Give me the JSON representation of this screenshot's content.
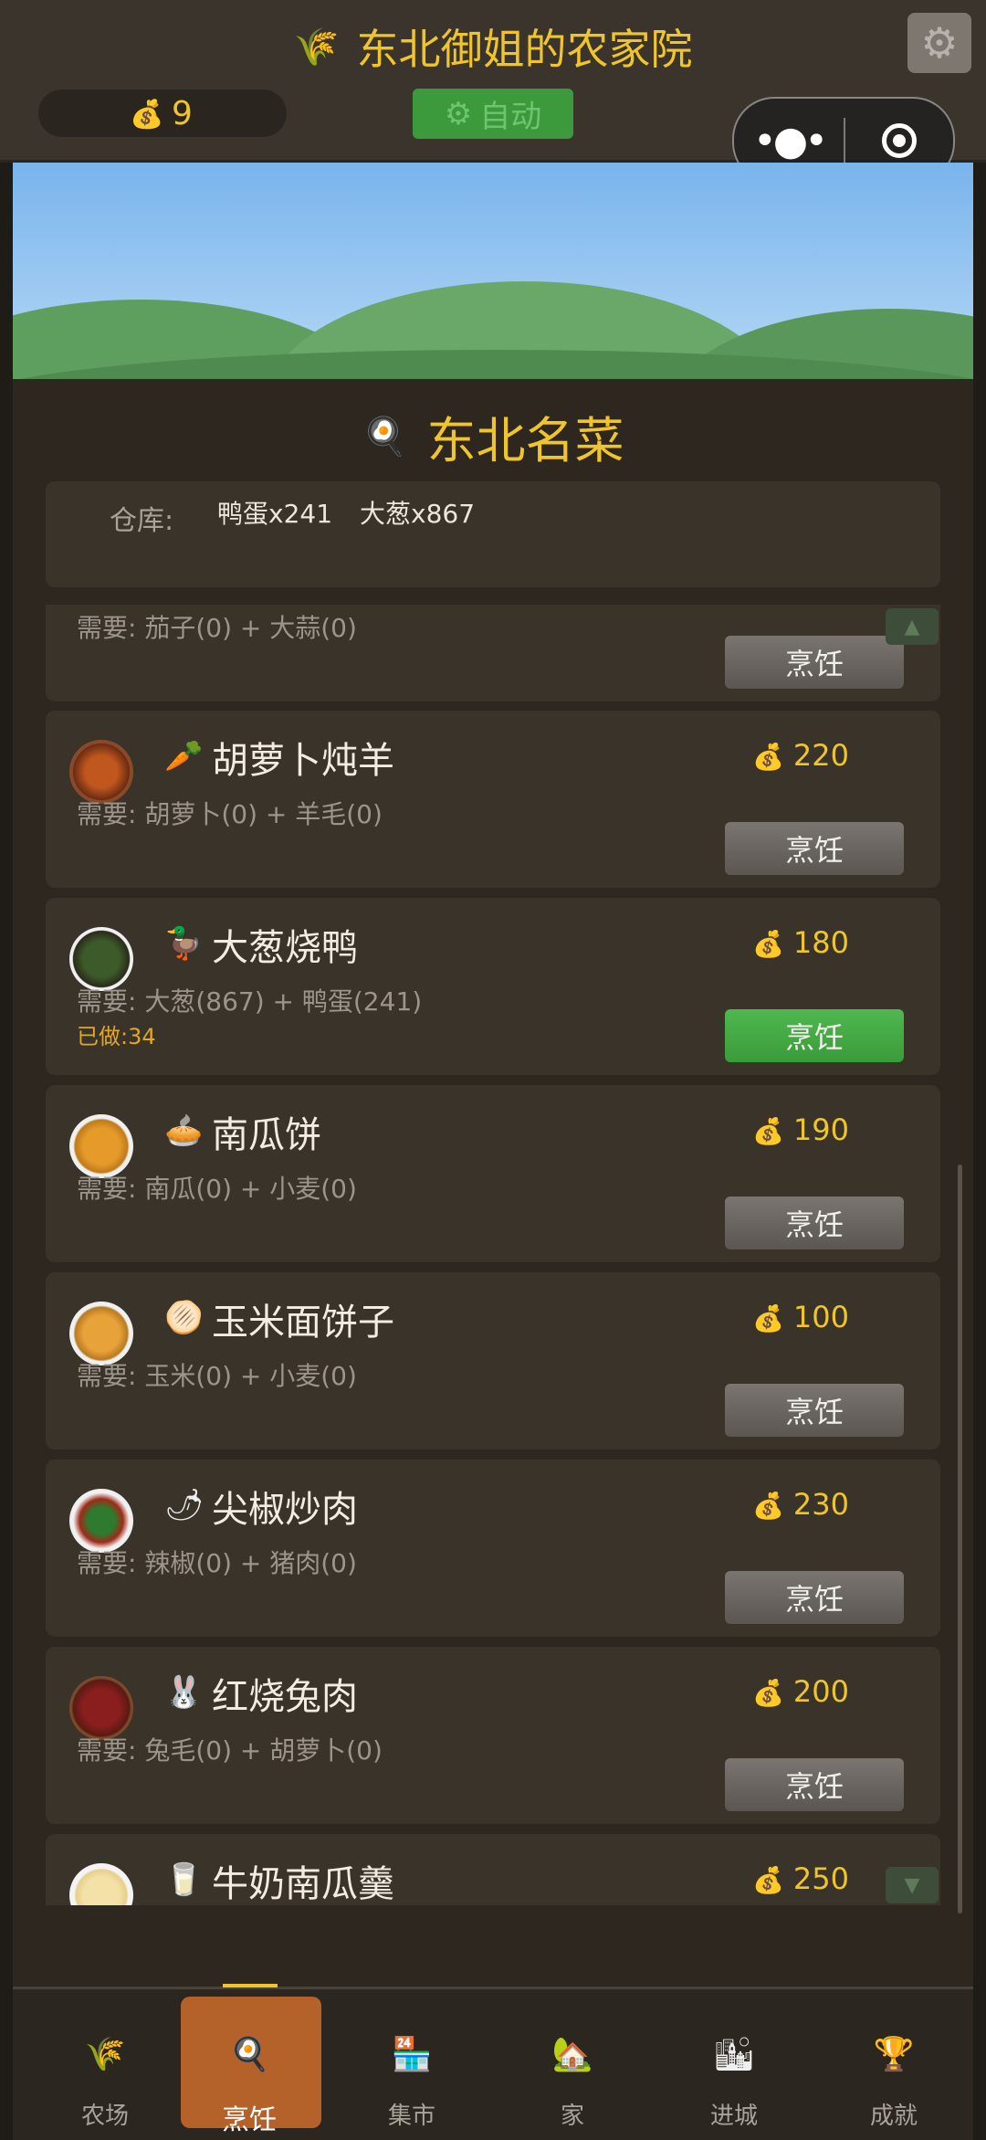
{
  "header": {
    "title": "东北御姐的农家院",
    "title_icon": "wheat-icon",
    "coins": "9",
    "auto_label": "自动",
    "settings_icon": "gear-icon"
  },
  "panel": {
    "title": "东北名菜",
    "title_icon": "frying-pan-icon",
    "warehouse_label": "仓库:",
    "warehouse_items": [
      "鸭蛋x241",
      "大葱x867"
    ]
  },
  "recipes": [
    {
      "name": "",
      "emoji": "",
      "price": "",
      "requires": "需要: 茄子(0) + 大蒜(0)",
      "done": "",
      "cook_label": "烹饪",
      "can_cook": false
    },
    {
      "name": "胡萝卜炖羊",
      "emoji": "carrot-icon",
      "price": "220",
      "requires": "需要: 胡萝卜(0) + 羊毛(0)",
      "done": "",
      "cook_label": "烹饪",
      "can_cook": false
    },
    {
      "name": "大葱烧鸭",
      "emoji": "duck-icon",
      "price": "180",
      "requires": "需要: 大葱(867) + 鸭蛋(241)",
      "done": "已做:34",
      "cook_label": "烹饪",
      "can_cook": true
    },
    {
      "name": "南瓜饼",
      "emoji": "pie-icon",
      "price": "190",
      "requires": "需要: 南瓜(0) + 小麦(0)",
      "done": "",
      "cook_label": "烹饪",
      "can_cook": false
    },
    {
      "name": "玉米面饼子",
      "emoji": "flatbread-icon",
      "price": "100",
      "requires": "需要: 玉米(0) + 小麦(0)",
      "done": "",
      "cook_label": "烹饪",
      "can_cook": false
    },
    {
      "name": "尖椒炒肉",
      "emoji": "chili-icon",
      "price": "230",
      "requires": "需要: 辣椒(0) + 猪肉(0)",
      "done": "",
      "cook_label": "烹饪",
      "can_cook": false
    },
    {
      "name": "红烧兔肉",
      "emoji": "rabbit-icon",
      "price": "200",
      "requires": "需要: 兔毛(0) + 胡萝卜(0)",
      "done": "",
      "cook_label": "烹饪",
      "can_cook": false
    },
    {
      "name": "牛奶南瓜羹",
      "emoji": "milk-icon",
      "price": "250",
      "requires": "",
      "done": "",
      "cook_label": "",
      "can_cook": false
    }
  ],
  "tabs": [
    {
      "label": "农场",
      "icon": "wheat-icon",
      "active": false
    },
    {
      "label": "烹饪",
      "icon": "frying-pan-icon",
      "active": true
    },
    {
      "label": "集市",
      "icon": "store-icon",
      "active": false
    },
    {
      "label": "家",
      "icon": "house-icon",
      "active": false
    },
    {
      "label": "进城",
      "icon": "city-icon",
      "active": false
    },
    {
      "label": "成就",
      "icon": "trophy-icon",
      "active": false
    }
  ]
}
